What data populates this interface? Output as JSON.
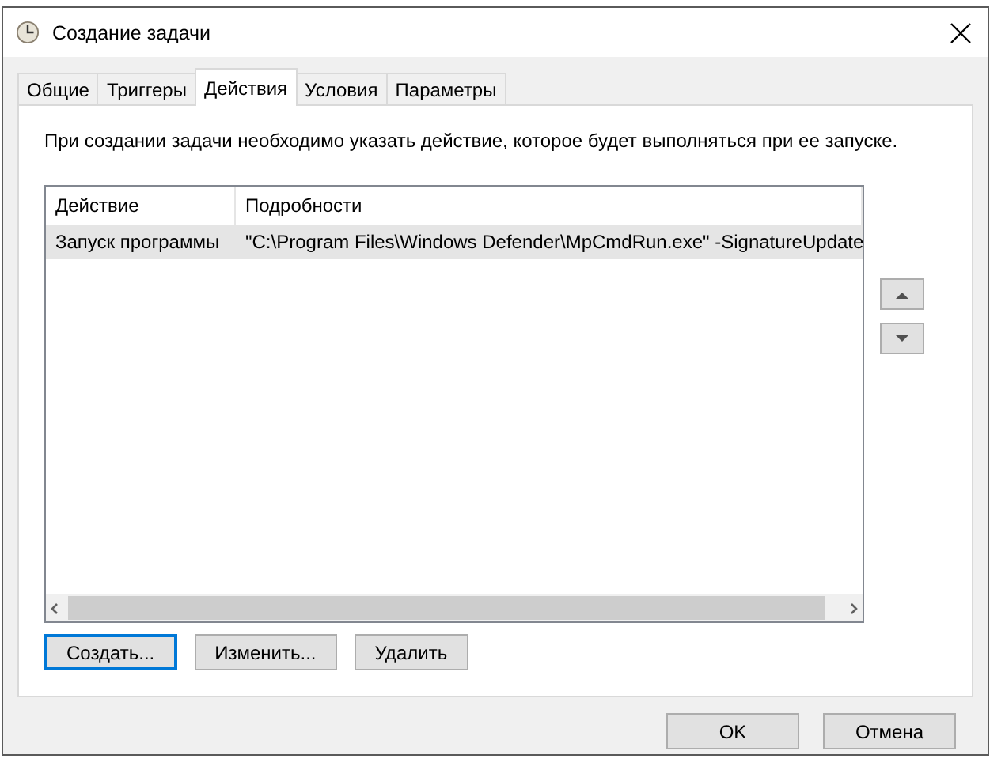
{
  "window": {
    "title": "Создание задачи"
  },
  "tabs": [
    {
      "label": "Общие",
      "selected": false
    },
    {
      "label": "Триггеры",
      "selected": false
    },
    {
      "label": "Действия",
      "selected": true
    },
    {
      "label": "Условия",
      "selected": false
    },
    {
      "label": "Параметры",
      "selected": false
    }
  ],
  "description": "При создании задачи необходимо указать действие, которое будет выполняться при ее запуске.",
  "table": {
    "columns": [
      "Действие",
      "Подробности"
    ],
    "rows": [
      {
        "cells": [
          "Запуск программы",
          "\"C:\\Program Files\\Windows Defender\\MpCmdRun.exe\" -SignatureUpdate"
        ],
        "selected": true
      }
    ]
  },
  "list_buttons": [
    {
      "label": "Создать...",
      "focused": true
    },
    {
      "label": "Изменить...",
      "focused": false
    },
    {
      "label": "Удалить",
      "focused": false
    }
  ],
  "dialog_buttons": [
    "OK",
    "Отмена"
  ]
}
